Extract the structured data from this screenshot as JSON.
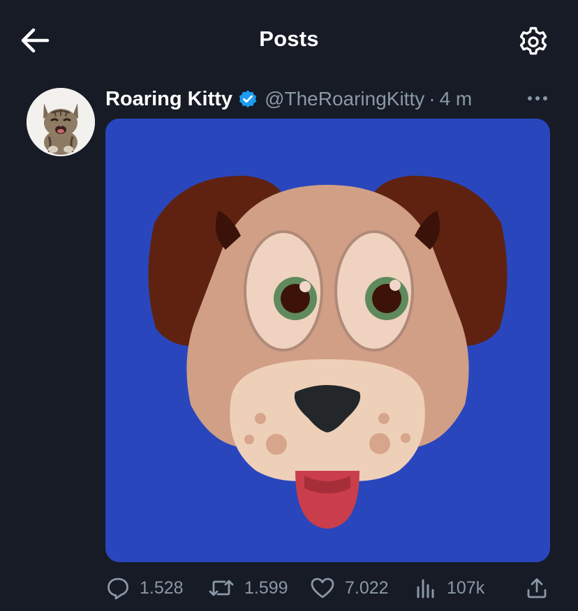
{
  "header": {
    "title": "Posts",
    "back_icon": "arrow-left-icon",
    "settings_icon": "gear-icon"
  },
  "post": {
    "author_name": "Roaring Kitty",
    "verified": true,
    "handle": "@TheRoaringKitty",
    "separator": "·",
    "time": "4 m",
    "more_icon": "more-horizontal-icon",
    "media_icon": "dog-face-emoji",
    "media_background": "#2a46bd"
  },
  "actions": {
    "replies": "1.528",
    "reposts": "1.599",
    "likes": "7.022",
    "views": "107k"
  },
  "colors": {
    "background": "#161b26",
    "text_primary": "#ffffff",
    "text_secondary": "#8b98a5",
    "verified_blue": "#1d9bf0"
  }
}
